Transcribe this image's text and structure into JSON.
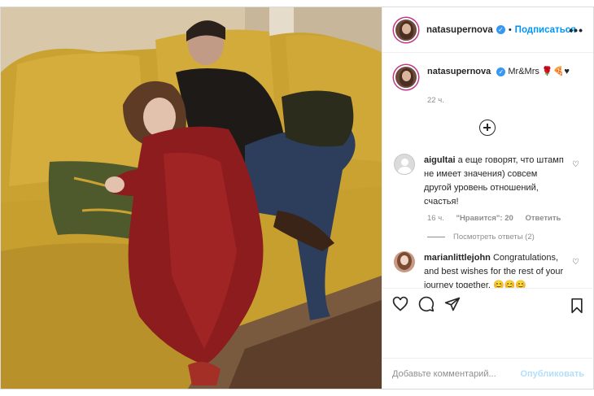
{
  "post": {
    "username": "natasupernova",
    "follow_label": "Подписаться",
    "caption": "Mr&Mrs 🌹🍕♥",
    "time_ago": "22 ч.",
    "more_label": "•••"
  },
  "comments": [
    {
      "username": "aigultai",
      "text": "а еще говорят, что штамп не имеет значения) совсем другой уровень отношений, счастья!",
      "time": "16 ч.",
      "likes": "\"Нравится\": 20",
      "reply_label": "Ответить",
      "view_replies": "Посмотреть ответы (2)"
    },
    {
      "username": "marianlittlejohn",
      "text": "Congratulations, and best wishes for the rest of your journey together. 😊😊😊"
    }
  ],
  "add_comment": {
    "placeholder": "Добавьте комментарий...",
    "post_label": "Опубликовать"
  },
  "icons": [
    "heart-icon",
    "comment-icon",
    "share-icon",
    "bookmark-icon",
    "plus-circle-icon",
    "verified-icon"
  ],
  "colors": {
    "accent": "#0095f6",
    "disabled_post": "#b2dffc",
    "verified": "#3897f0"
  }
}
